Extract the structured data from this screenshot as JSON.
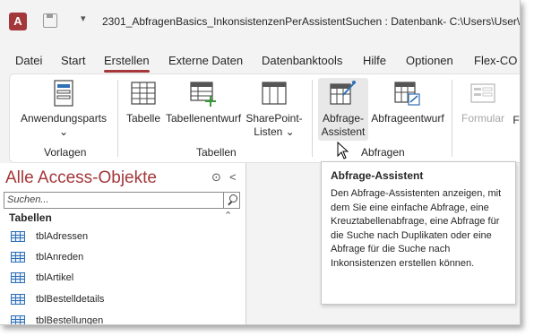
{
  "window": {
    "title": "2301_AbfragenBasics_InkonsistenzenPerAssistentSuchen : Datenbank- C:\\Users\\User\\Dr",
    "app_icon_letter": "A",
    "qat_more": "▾"
  },
  "tabs": [
    "Datei",
    "Start",
    "Erstellen",
    "Externe Daten",
    "Datenbanktools",
    "Hilfe",
    "Optionen",
    "Flex-CO"
  ],
  "active_tab": "Erstellen",
  "ribbon": {
    "anwendungsparts": "Anwendungsparts",
    "anwendungsparts_arrow": "⌄",
    "tabelle": "Tabelle",
    "tabellenentwurf": "Tabellenentwurf",
    "sharepoint_line1": "SharePoint-",
    "sharepoint_line2": "Listen ⌄",
    "abfrage_line1": "Abfrage-",
    "abfrage_line2": "Assistent",
    "abfrageentwurf": "Abfrageentwurf",
    "formular": "Formular",
    "next_cut": "F",
    "groups": {
      "vorlagen": "Vorlagen",
      "tabellen": "Tabellen",
      "abfragen": "Abfragen"
    }
  },
  "nav": {
    "title": "Alle Access-Objekte",
    "menu_glyph": "⊙",
    "shutter_glyph": "<",
    "search_placeholder": "Suchen...",
    "section": "Tabellen",
    "collapse_glyph": "⌃",
    "items": [
      "tblAdressen",
      "tblAnreden",
      "tblArtikel",
      "tblBestelldetails",
      "tblBestellungen"
    ]
  },
  "tooltip": {
    "title": "Abfrage-Assistent",
    "body": "Den Abfrage-Assistenten anzeigen, mit dem Sie eine einfache Abfrage, eine Kreuztabellenabfrage, eine Abfrage für die Suche nach Duplikaten oder eine Abfrage für die Suche nach Inkonsistenzen erstellen können."
  },
  "colors": {
    "accent": "#a4373a",
    "table_icon": "#2e6fb5",
    "ribbon_bg": "#ffffff",
    "chrome_bg": "#f3f3f3"
  }
}
